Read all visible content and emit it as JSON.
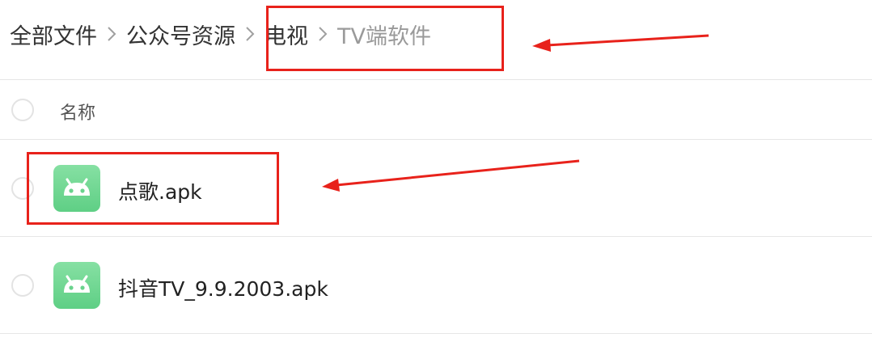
{
  "breadcrumb": {
    "items": [
      "全部文件",
      "公众号资源",
      "电视"
    ],
    "current": "TV端软件"
  },
  "table": {
    "header_label": "名称"
  },
  "files": [
    {
      "name": "点歌.apk",
      "icon": "android-app-icon"
    },
    {
      "name": "抖音TV_9.9.2003.apk",
      "icon": "android-app-icon"
    }
  ],
  "colors": {
    "annotation": "#e8221b",
    "apk_icon": "#6ad38d",
    "crumb_active": "#333333",
    "crumb_current": "#9a9a9a"
  }
}
